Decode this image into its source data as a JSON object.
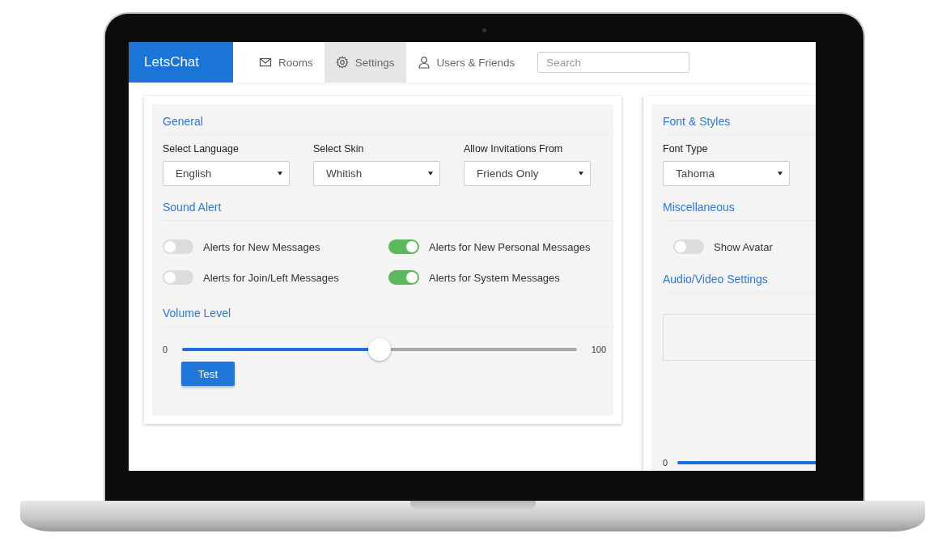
{
  "app": {
    "logo": "LetsChat"
  },
  "nav": [
    {
      "label": "Rooms",
      "kind": "mail",
      "selected": false
    },
    {
      "label": "Settings",
      "kind": "gear",
      "selected": true
    },
    {
      "label": "Users & Friends",
      "kind": "user",
      "selected": false
    }
  ],
  "search": {
    "placeholder": "Search"
  },
  "general": {
    "title": "General",
    "selects": [
      {
        "label": "Select Language",
        "value": "English"
      },
      {
        "label": "Select Skin",
        "value": "Whitish"
      },
      {
        "label": "Allow Invitations From",
        "value": "Friends Only"
      }
    ]
  },
  "sound_alert": {
    "title": "Sound Alert",
    "toggles": [
      {
        "label": "Alerts for New Messages",
        "on": false
      },
      {
        "label": "Alerts for New Personal Messages",
        "on": true
      },
      {
        "label": "Alerts for Join/Left Messages",
        "on": false
      },
      {
        "label": "Alerts for System Messages",
        "on": true
      }
    ]
  },
  "volume": {
    "title": "Volume Level",
    "min": "0",
    "max": "100",
    "level": 0.5,
    "button": "Test"
  },
  "font_styles": {
    "title": "Font & Styles",
    "selects": [
      {
        "label": "Font Type",
        "value": "Tahoma"
      }
    ]
  },
  "misc": {
    "title": "Miscellaneous",
    "toggles": [
      {
        "label": "Show Avatar",
        "on": false
      }
    ]
  },
  "audio_video": {
    "title": "Audio/Video Settings",
    "slider_min": "0"
  }
}
